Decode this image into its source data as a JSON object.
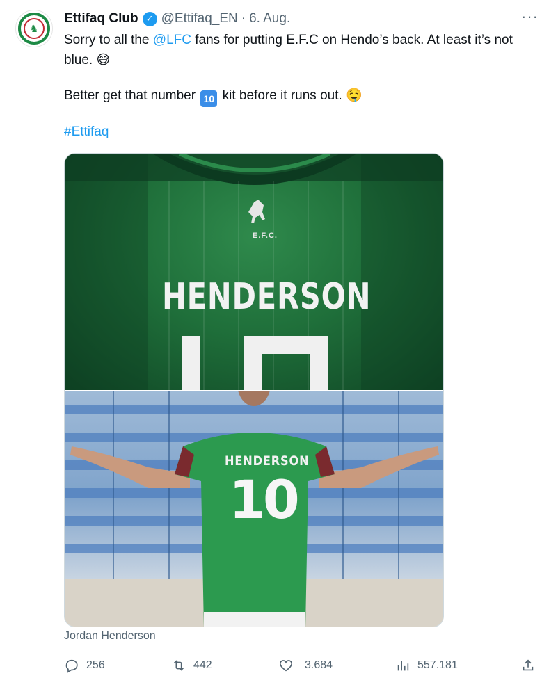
{
  "author": {
    "name": "Ettifaq Club",
    "handle": "@Ettifaq_EN",
    "separator": "·",
    "date": "6. Aug."
  },
  "tweet": {
    "line1_pre": "Sorry to all the ",
    "mention": "@LFC",
    "line1_post": " fans for putting E.F.C on Hendo’s back. At least it’s not blue.",
    "line1_emoji": "😅",
    "line2_pre": "Better get that number ",
    "line2_keycap": "10",
    "line2_post": " kit before it runs out.",
    "line2_emoji": "🤤",
    "hashtag": "#Ettifaq"
  },
  "media": {
    "photo1_shirt_brand": "E.F.C.",
    "photo1_shirt_name": "HENDERSON",
    "photo2_shirt_name": "HENDERSON",
    "photo2_shirt_number": "10",
    "caption": "Jordan Henderson"
  },
  "metrics": {
    "replies": "256",
    "reposts": "442",
    "likes": "3.684",
    "views": "557.181"
  },
  "icons": {
    "more": "more-dots-icon",
    "verified": "verified-badge-icon",
    "reply": "reply-icon",
    "repost": "repost-icon",
    "like": "heart-icon",
    "views": "views-icon",
    "share": "share-icon"
  },
  "colors": {
    "link": "#1d9bf0",
    "secondary_text": "#536471",
    "primary_text": "#0f1419",
    "verified": "#1d9bf0"
  }
}
